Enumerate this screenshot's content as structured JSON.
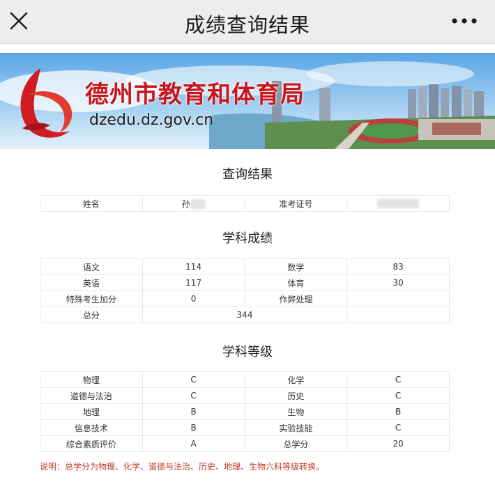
{
  "topbar": {
    "title": "成绩查询结果",
    "close_icon": "close-icon",
    "more_icon": "more-icon"
  },
  "banner": {
    "title": "德州市教育和体育局",
    "url": "dzedu.dz.gov.cn",
    "logo_icon": "ribbon-logo-icon",
    "accent_color": "#c8161d"
  },
  "query": {
    "heading": "查询结果",
    "name_label": "姓名",
    "name_value": "孙",
    "ticket_label": "准考证号",
    "ticket_value": ""
  },
  "scores": {
    "heading": "学科成绩",
    "rows": [
      [
        "语文",
        "114",
        "数学",
        "83"
      ],
      [
        "英语",
        "117",
        "体育",
        "30"
      ],
      [
        "特殊考生加分",
        "0",
        "作弊处理",
        ""
      ]
    ],
    "total_label": "总分",
    "total_value": "344"
  },
  "grades": {
    "heading": "学科等级",
    "rows": [
      [
        "物理",
        "C",
        "化学",
        "C"
      ],
      [
        "道德与法治",
        "C",
        "历史",
        "C"
      ],
      [
        "地理",
        "B",
        "生物",
        "B"
      ],
      [
        "信息技术",
        "B",
        "实验技能",
        "C"
      ],
      [
        "综合素质评价",
        "A",
        "总学分",
        "20"
      ]
    ]
  },
  "note": "说明：总学分为物理、化学、道德与法治、历史、地理、生物六科等级转换。"
}
